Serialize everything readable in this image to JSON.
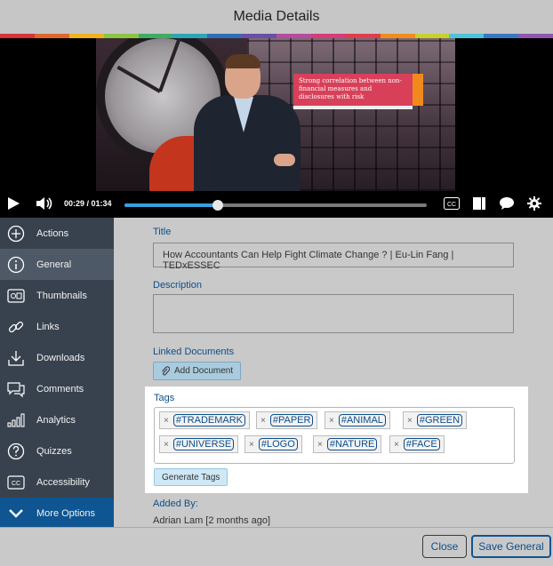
{
  "header": {
    "title": "Media Details"
  },
  "brand_colors": [
    "#d6343a",
    "#e0672a",
    "#f0b21e",
    "#8cc541",
    "#3cae62",
    "#2aa6b8",
    "#2d6fb6",
    "#6a4ea8",
    "#b84aa0",
    "#d83a7a",
    "#e23c4c",
    "#f38c1c",
    "#c8d02a",
    "#4cc3d9",
    "#3a76c2",
    "#8f56b0"
  ],
  "player": {
    "caption": "Strong correlation between non-financial measures and disclosures with risk",
    "time": "00:29 / 01:34",
    "progress": 0.31,
    "icons": [
      "play-icon",
      "volume-icon",
      "closed-captions-icon",
      "sidebar-toggle-icon",
      "chat-icon",
      "settings-gear-icon"
    ],
    "cc_label": "CC"
  },
  "sidebar": {
    "items": [
      {
        "label": "Actions",
        "icon": "plus-circle-icon"
      },
      {
        "label": "General",
        "icon": "info-circle-icon"
      },
      {
        "label": "Thumbnails",
        "icon": "thumbnails-icon"
      },
      {
        "label": "Links",
        "icon": "link-icon"
      },
      {
        "label": "Downloads",
        "icon": "download-icon"
      },
      {
        "label": "Comments",
        "icon": "comments-icon"
      },
      {
        "label": "Analytics",
        "icon": "analytics-icon"
      },
      {
        "label": "Quizzes",
        "icon": "question-circle-icon"
      },
      {
        "label": "Accessibility",
        "icon": "cc-icon"
      },
      {
        "label": "More Options",
        "icon": "chevron-down-icon"
      }
    ],
    "active": "General",
    "cc_icon_text": "CC"
  },
  "form": {
    "title_label": "Title",
    "title_value": "How Accountants Can Help Fight Climate Change ? | Eu-Lin Fang | TEDxESSEC",
    "description_label": "Description",
    "description_value": "",
    "linked_label": "Linked Documents",
    "add_document": "Add Document",
    "tags_label": "Tags",
    "tags": [
      "#TRADEMARK",
      "#PAPER",
      "#ANIMAL",
      "#GREEN",
      "#UNIVERSE",
      "#LOGO",
      "#NATURE",
      "#FACE"
    ],
    "tag_remove": "×",
    "generate_tags": "Generate Tags",
    "added_by_label": "Added By:",
    "added_by_value": "Adrian Lam [2 months ago]"
  },
  "footer": {
    "close": "Close",
    "save": "Save General"
  }
}
